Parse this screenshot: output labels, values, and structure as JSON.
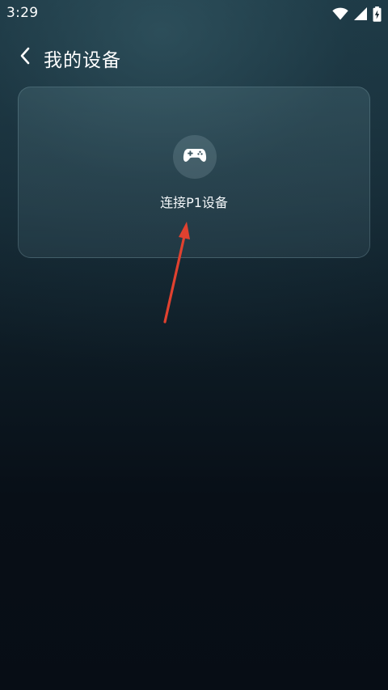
{
  "status_bar": {
    "time": "3:29",
    "icons": [
      "wifi-icon",
      "cellular-signal-icon",
      "battery-charging-icon"
    ]
  },
  "header": {
    "back_icon": "chevron-left-icon",
    "title": "我的设备"
  },
  "device_card": {
    "icon": "gamepad-icon",
    "label": "连接P1设备"
  },
  "annotation": {
    "type": "arrow",
    "color": "#e0412f"
  },
  "colors": {
    "background_top": "#1d3a46",
    "background_bottom": "#070d15",
    "text": "#ffffff"
  }
}
